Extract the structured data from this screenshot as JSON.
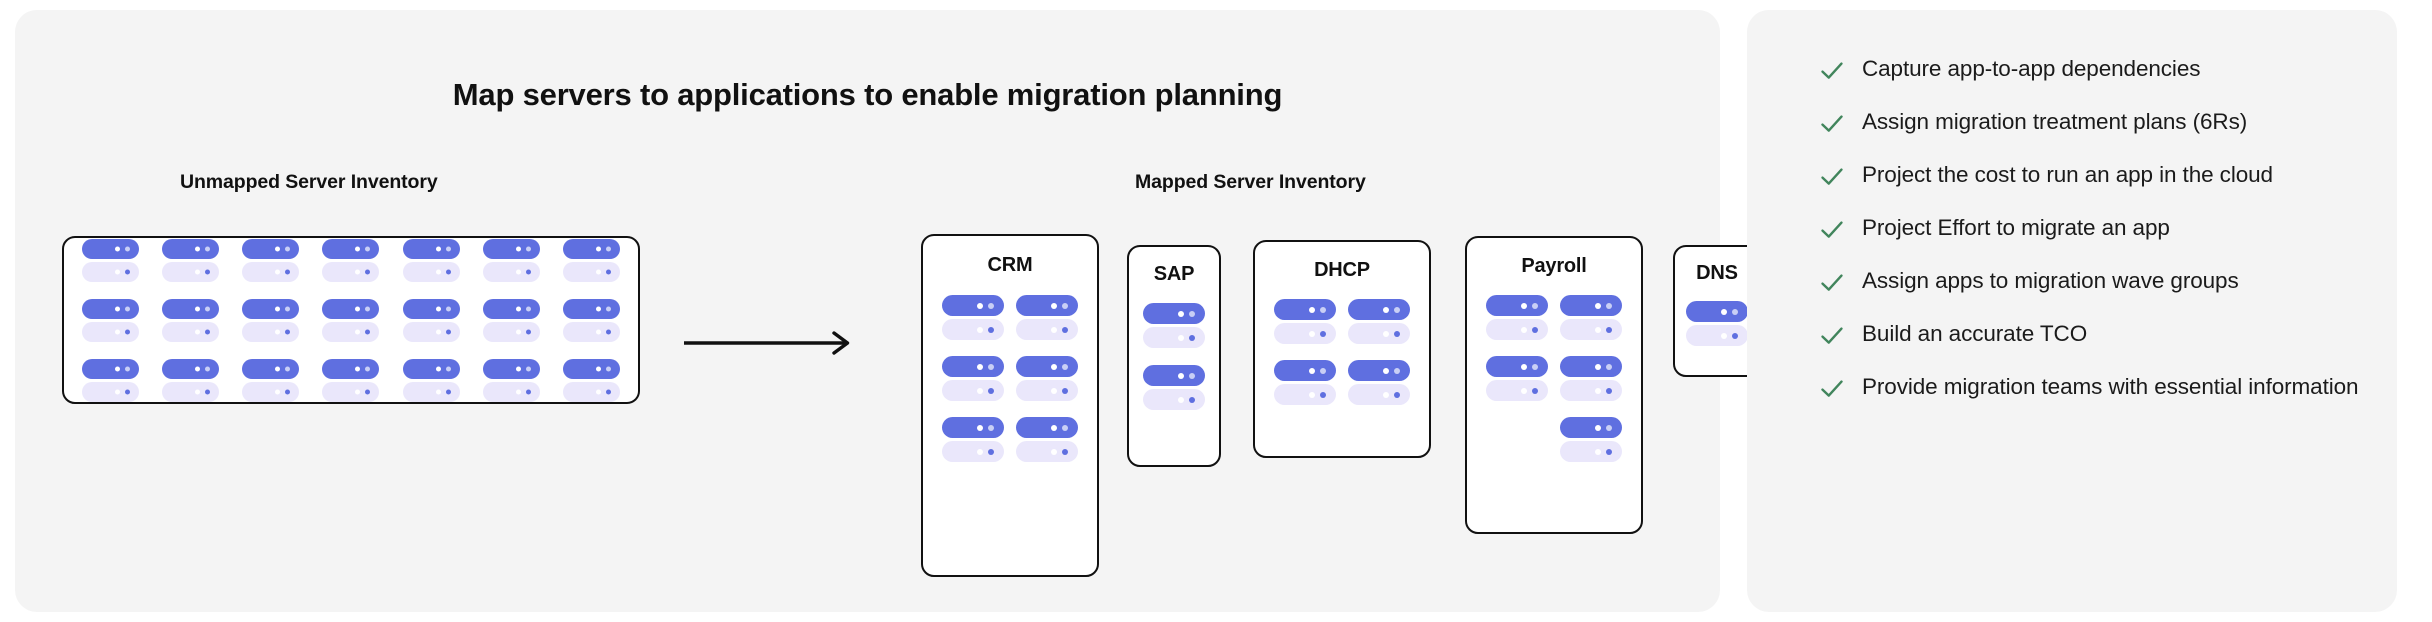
{
  "diagram": {
    "title": "Map servers to applications to enable migration planning",
    "unmapped_label": "Unmapped Server Inventory",
    "mapped_label": "Mapped Server Inventory",
    "arrow_icon": "arrow-right-icon",
    "unmapped_inventory": {
      "rows": 3,
      "columns": 7,
      "total_servers": 21
    },
    "applications": [
      {
        "name": "CRM",
        "server_count": 6,
        "layout": "3 rows x 2 columns"
      },
      {
        "name": "SAP",
        "server_count": 2,
        "layout": "2 rows x 1 column"
      },
      {
        "name": "DHCP",
        "server_count": 4,
        "layout": "2 rows x 2 columns"
      },
      {
        "name": "Payroll",
        "server_count": 5,
        "layout": "2 rows x 2 columns + 1"
      },
      {
        "name": "DNS",
        "server_count": 1,
        "layout": "1 row x 1 column"
      }
    ]
  },
  "checklist": {
    "check_icon": "check-icon",
    "items": [
      "Capture app-to-app dependencies",
      "Assign migration treatment plans (6Rs)",
      "Project the cost to run an app in the cloud",
      "Project Effort to migrate an app",
      "Assign apps to migration wave groups",
      "Build an accurate TCO",
      "Provide migration teams with essential information"
    ]
  },
  "colors": {
    "panel_background": "#f4f4f4",
    "page_background": "#ffffff",
    "server_primary": "#5f6fe0",
    "server_secondary": "#eae7fb",
    "outline": "#111111",
    "check_green": "#41855c",
    "text": "#1b1b1b"
  }
}
